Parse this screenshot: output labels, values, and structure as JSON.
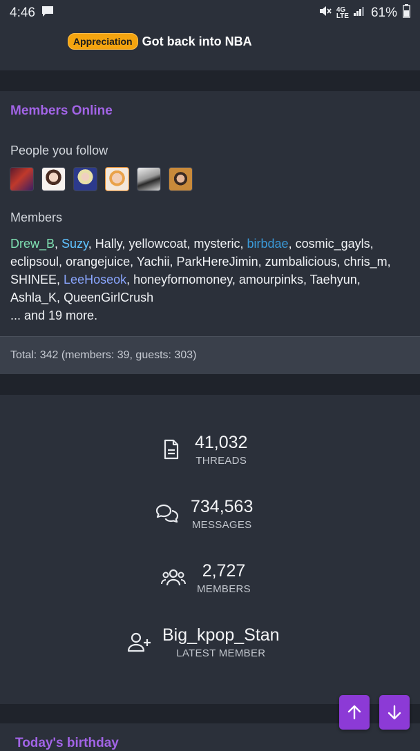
{
  "status_bar": {
    "time": "4:46",
    "battery": "61%",
    "network": "4G LTE"
  },
  "top_thread": {
    "prefix_badge": "Appreciation",
    "title": "Got back into NBA"
  },
  "members_online": {
    "title": "Members Online",
    "people_you_follow_label": "People you follow",
    "members_label": "Members",
    "members": [
      {
        "name": "Drew_B",
        "color": "#7fe0b2"
      },
      {
        "name": "Suzy",
        "color": "#5fc2ff"
      },
      {
        "name": "Hally"
      },
      {
        "name": "yellowcoat"
      },
      {
        "name": "mysteric"
      },
      {
        "name": "birbdae",
        "color": "#3a9ad9"
      },
      {
        "name": "cosmic_gayls"
      },
      {
        "name": "eclipsoul"
      },
      {
        "name": "orangejuice"
      },
      {
        "name": "Yachii"
      },
      {
        "name": "ParkHereJimin"
      },
      {
        "name": "zumbalicious"
      },
      {
        "name": "chris_m"
      },
      {
        "name": "SHINEE"
      },
      {
        "name": "LeeHoseok",
        "color": "#8aa6ff"
      },
      {
        "name": "honeyfornomoney"
      },
      {
        "name": "amourpinks"
      },
      {
        "name": "Taehyun"
      },
      {
        "name": "Ashla_K"
      },
      {
        "name": "QueenGirlCrush"
      }
    ],
    "more_text": "... and 19 more.",
    "total_text": "Total: 342 (members: 39, guests: 303)"
  },
  "stats": {
    "threads": {
      "value": "41,032",
      "label": "THREADS",
      "icon": "document-icon"
    },
    "messages": {
      "value": "734,563",
      "label": "MESSAGES",
      "icon": "chat-bubbles-icon"
    },
    "members": {
      "value": "2,727",
      "label": "MEMBERS",
      "icon": "users-group-icon"
    },
    "latest_member": {
      "value": "Big_kpop_Stan",
      "label": "LATEST MEMBER",
      "icon": "user-plus-icon"
    }
  },
  "birthday": {
    "title": "Today's birthday"
  },
  "colors": {
    "accent": "#a264e6",
    "badge": "#f4a40f",
    "scroll_button": "#8c3ad6"
  }
}
